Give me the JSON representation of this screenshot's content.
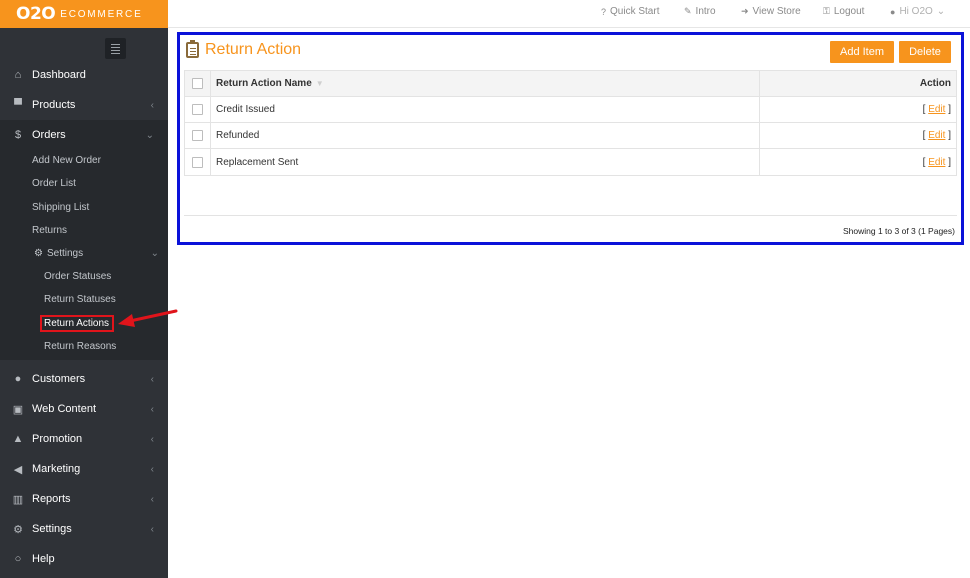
{
  "brand": {
    "mark": "O2O",
    "word": "ECOMMERCE"
  },
  "sidebar": {
    "items": [
      {
        "label": "Dashboard",
        "icon": "home-icon"
      },
      {
        "label": "Products",
        "icon": "cart-icon"
      },
      {
        "label": "Orders",
        "icon": "dollar-icon"
      },
      {
        "label": "Customers",
        "icon": "user-icon"
      },
      {
        "label": "Web Content",
        "icon": "book-icon"
      },
      {
        "label": "Promotion",
        "icon": "thumbs-up-icon"
      },
      {
        "label": "Marketing",
        "icon": "megaphone-icon"
      },
      {
        "label": "Reports",
        "icon": "bar-chart-icon"
      },
      {
        "label": "Settings",
        "icon": "gears-icon"
      },
      {
        "label": "Help",
        "icon": "chat-icon"
      }
    ],
    "orders_sub": [
      "Add New Order",
      "Order List",
      "Shipping List",
      "Returns"
    ],
    "settings_label": "Settings",
    "settings_sub": [
      "Order Statuses",
      "Return Statuses",
      "Return Actions",
      "Return Reasons"
    ]
  },
  "topbar": {
    "links": [
      "Quick Start",
      "Intro",
      "View Store",
      "Logout"
    ],
    "user": "Hi O2O"
  },
  "panel": {
    "title": "Return Action",
    "add_label": "Add Item",
    "delete_label": "Delete",
    "columns": [
      "Return Action Name",
      "Action"
    ],
    "rows": [
      "Credit Issued",
      "Refunded",
      "Replacement Sent"
    ],
    "edit_label": "Edit",
    "showing": "Showing 1 to 3 of 3 (1 Pages)"
  },
  "colors": {
    "accent": "#f7941d",
    "sidebar": "#2f3237",
    "highlight_border": "#0b12d9",
    "annotation": "#e0141b"
  }
}
